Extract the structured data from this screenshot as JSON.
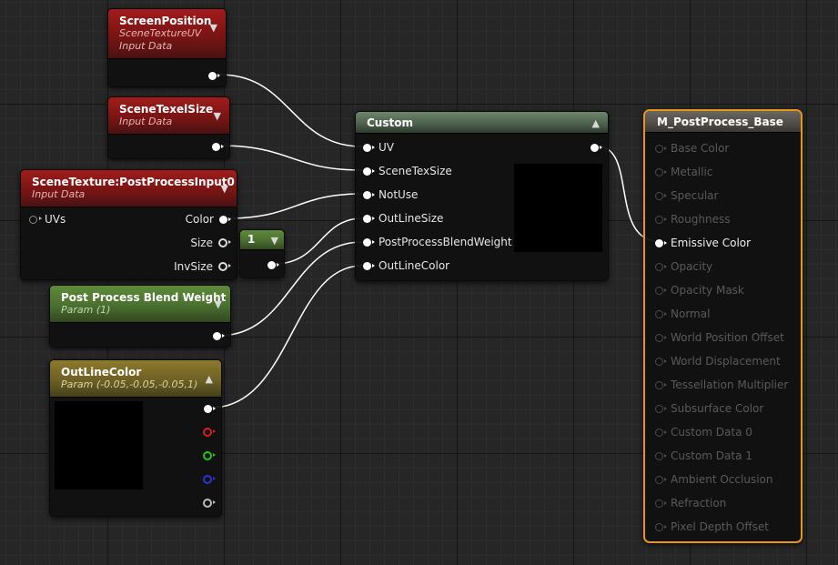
{
  "colors": {
    "accent_result": "#e8951c",
    "input_header": "#8e1818",
    "param_scalar_header": "#4a7030",
    "param_vector_header": "#6e6025",
    "custom_header": "#4b5e4b",
    "wire": "#ffffff"
  },
  "nodes": {
    "screen_position": {
      "title": "ScreenPosition",
      "subtitle1": "SceneTextureUV",
      "subtitle2": "Input Data",
      "icon": "chevron-down-icon"
    },
    "scene_texel_size": {
      "title": "SceneTexelSize",
      "subtitle": "Input Data",
      "icon": "chevron-down-icon"
    },
    "scene_texture": {
      "title": "SceneTexture:PostProcessInput0",
      "subtitle": "Input Data",
      "icon": "chevron-down-icon",
      "input_uvs": "UVs",
      "out_color": "Color",
      "out_size": "Size",
      "out_invsize": "InvSize"
    },
    "constant": {
      "value": "1",
      "icon": "chevron-down-icon"
    },
    "blend_weight": {
      "title": "Post Process Blend Weight",
      "subtitle": "Param (1)",
      "icon": "chevron-down-icon"
    },
    "outline_color": {
      "title": "OutLineColor",
      "subtitle": "Param (-0.05,-0.05,-0.05,1)",
      "icon": "chevron-up-icon"
    },
    "custom": {
      "title": "Custom",
      "icon": "chevron-up-icon",
      "inputs": [
        "UV",
        "SceneTexSize",
        "NotUse",
        "OutLineSize",
        "PostProcessBlendWeight",
        "OutLineColor"
      ]
    },
    "material": {
      "title": "M_PostProcess_Base",
      "pins": [
        "Base Color",
        "Metallic",
        "Specular",
        "Roughness",
        "Emissive Color",
        "Opacity",
        "Opacity Mask",
        "Normal",
        "World Position Offset",
        "World Displacement",
        "Tessellation Multiplier",
        "Subsurface Color",
        "Custom Data 0",
        "Custom Data 1",
        "Ambient Occlusion",
        "Refraction",
        "Pixel Depth Offset"
      ],
      "active_pin": "Emissive Color"
    }
  }
}
